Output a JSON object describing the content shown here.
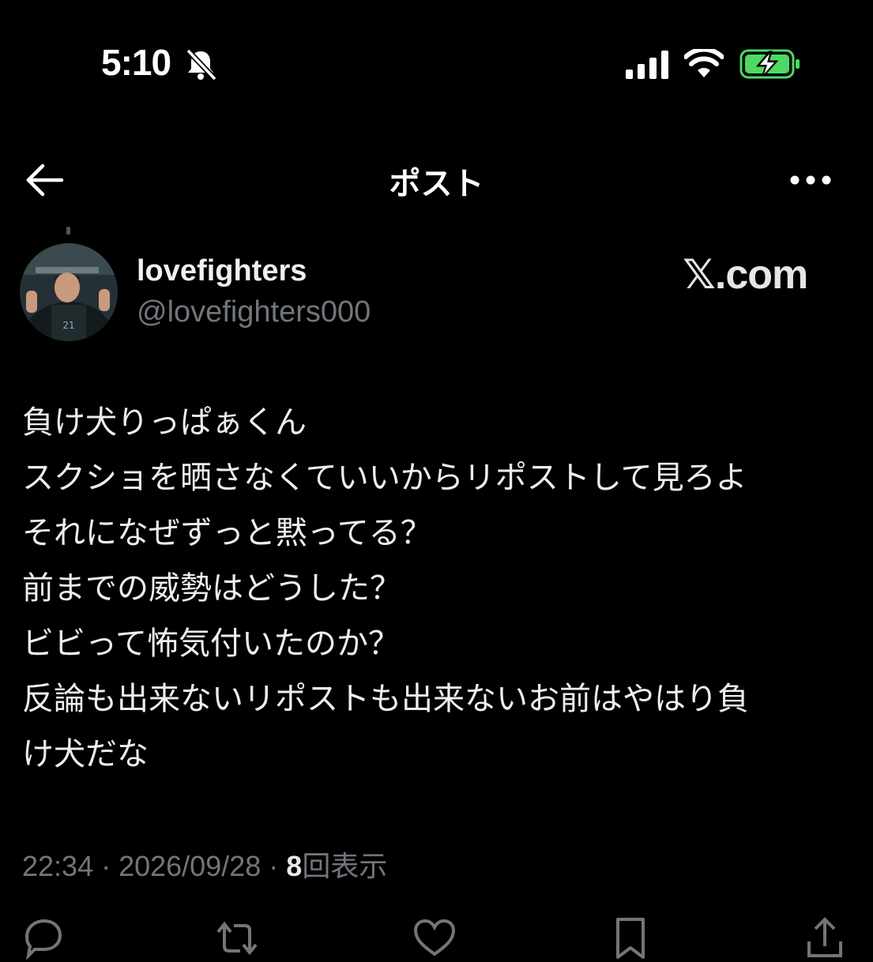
{
  "status_bar": {
    "time": "5:10"
  },
  "header": {
    "title": "ポスト"
  },
  "author": {
    "display_name": "lovefighters",
    "handle": "@lovefighters000"
  },
  "watermark": "𝕏.com",
  "post": {
    "lines": [
      "負け犬りっぱぁくん",
      "スクショを晒さなくていいからリポストして見ろよ",
      "それになぜずっと黙ってる？",
      "前までの威勢はどうした？",
      "ビビって怖気付いたのか？",
      "反論も出来ないリポストも出来ないお前はやはり負",
      "け犬だな"
    ]
  },
  "meta": {
    "time": "22:34",
    "separator": " · ",
    "date": "2026/09/28",
    "views_count": "8",
    "views_label": "回表示"
  },
  "colors": {
    "background": "#000000",
    "text": "#e7e9ea",
    "secondary_text": "#71767b",
    "battery": "#4cd964"
  }
}
